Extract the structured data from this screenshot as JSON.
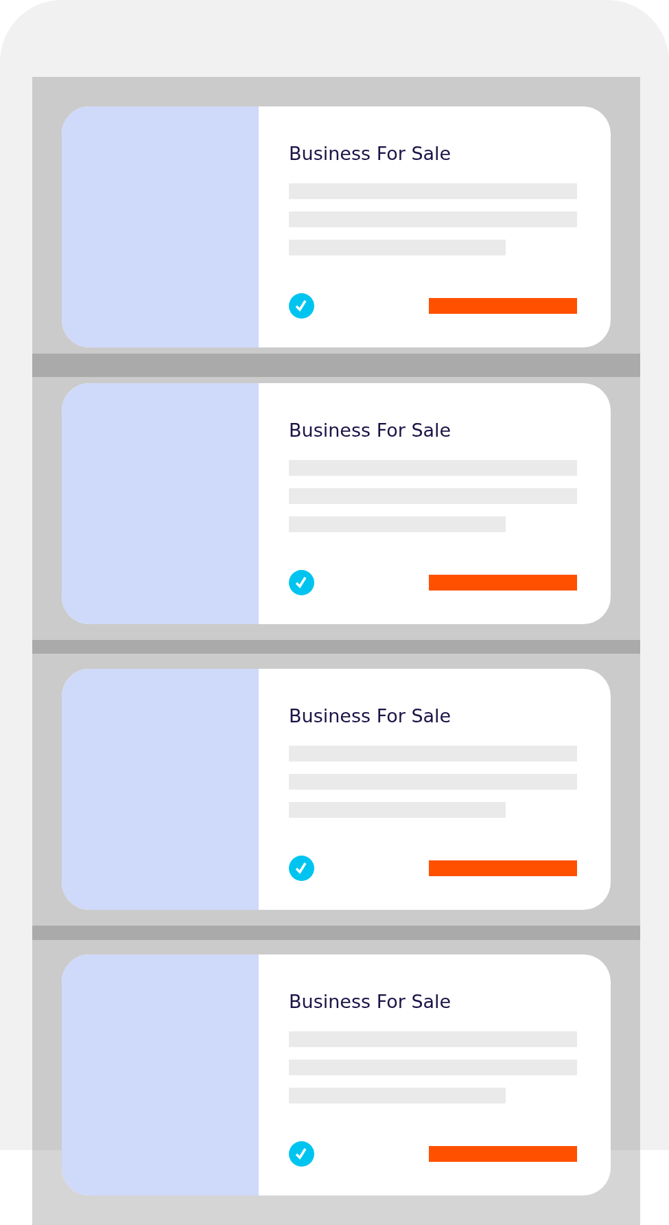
{
  "listings": [
    {
      "title": "Business For Sale",
      "verified": true
    },
    {
      "title": "Business For Sale",
      "verified": true
    },
    {
      "title": "Business For Sale",
      "verified": true
    },
    {
      "title": "Business For Sale",
      "verified": true
    }
  ]
}
